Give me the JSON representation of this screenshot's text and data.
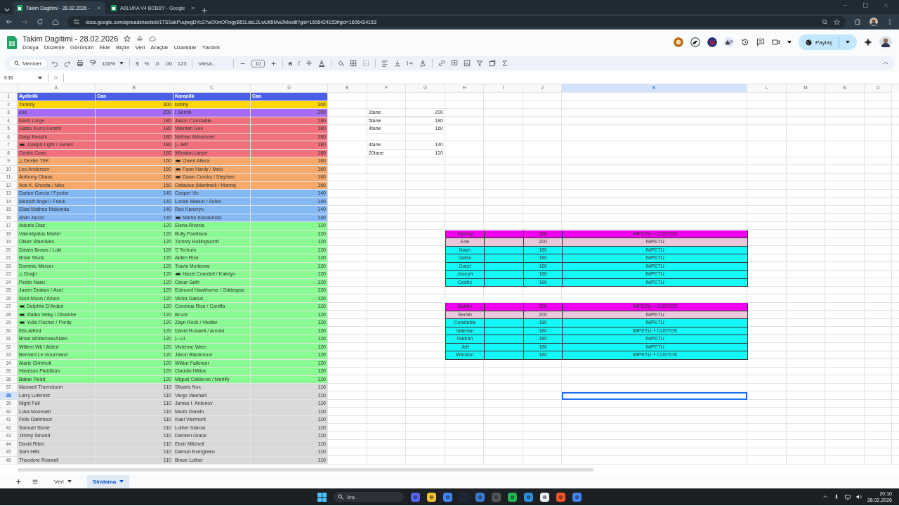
{
  "browser": {
    "tabs": [
      {
        "label": "Takim Dagitimi - 28.02.2026 -",
        "selected": true
      },
      {
        "label": "ABLUKA V4 BOBBY - Google",
        "selected": false
      }
    ],
    "address": "docs.google.com/spreadsheets/d/1TSSukPuujwgDYo37w0XmORngyB51LdcL2LwUti5Mw2M/edit?gid=1606424153#gid=1606424153"
  },
  "document": {
    "title": "Takim Dagitimi - 28.02.2026",
    "menus": [
      "Dosya",
      "Düzenle",
      "Görünüm",
      "Ekle",
      "Biçim",
      "Veri",
      "Araçlar",
      "Uzantılar",
      "Yardım"
    ],
    "share_label": "Paylaş"
  },
  "toolbar": {
    "search": "Menüler",
    "zoom": "100%",
    "currency": "$",
    "percent": "%",
    "decrease_decimals": ".0",
    "increase_decimals": ".00",
    "number_format": "123",
    "font": "Varsa...",
    "font_size": "10",
    "bold": "B",
    "italic": "I"
  },
  "formula_bar": {
    "name_box": "K38",
    "fx": "fx"
  },
  "columns": [
    {
      "label": "A",
      "selected": false
    },
    {
      "label": "B",
      "selected": false
    },
    {
      "label": "C",
      "selected": false
    },
    {
      "label": "D",
      "selected": false
    },
    {
      "label": "E",
      "selected": false
    },
    {
      "label": "F",
      "selected": false
    },
    {
      "label": "G",
      "selected": false
    },
    {
      "label": "H",
      "selected": false
    },
    {
      "label": "I",
      "selected": false
    },
    {
      "label": "J",
      "selected": false
    },
    {
      "label": "K",
      "selected": true
    },
    {
      "label": "L",
      "selected": false
    },
    {
      "label": "M",
      "selected": false
    },
    {
      "label": "N",
      "selected": false
    },
    {
      "label": "O",
      "selected": false
    }
  ],
  "rows": [
    {
      "number": "1",
      "selected": false,
      "kind": "header",
      "color": "#4a5ee6",
      "cells": [
        "Aydinlik",
        "Can",
        "Karanlik",
        "Can"
      ]
    },
    {
      "number": "2",
      "selected": false,
      "kind": "data",
      "color": "#ffd600",
      "cells": [
        "Tommy",
        "300",
        "bobby",
        "300"
      ]
    },
    {
      "number": "3",
      "selected": false,
      "kind": "data",
      "color": "#a66cf5",
      "cells": [
        "exe",
        "200",
        "I Semih",
        "200"
      ],
      "tally": [
        "1tane",
        "200"
      ]
    },
    {
      "number": "4",
      "selected": false,
      "kind": "data",
      "color": "#f0707c",
      "cells": [
        "Nash Lorge",
        "180",
        "Jason Constable",
        "180"
      ],
      "tally": [
        "5tane",
        "180"
      ]
    },
    {
      "number": "5",
      "selected": false,
      "kind": "data",
      "color": "#f0707c",
      "cells": [
        "Gatsu Kuroi Kenshi",
        "180",
        "Valerian Gek",
        "180"
      ],
      "tally": [
        "4tane",
        "160"
      ]
    },
    {
      "number": "6",
      "selected": false,
      "kind": "data",
      "color": "#f0707c",
      "cells": [
        "Daryl Kenshi",
        "180",
        "Nathan Ashmoore",
        "180"
      ]
    },
    {
      "number": "7",
      "selected": false,
      "kind": "data",
      "color": "#f0707c",
      "cells": [
        {
          "text": "Joseph Light / James",
          "emblem": true
        },
        "180",
        "▷ Jeff",
        "180"
      ],
      "tally": [
        "4tane",
        "140"
      ]
    },
    {
      "number": "8",
      "selected": false,
      "kind": "data",
      "color": "#f0707c",
      "cells": [
        "Cedric Cean",
        "180",
        "Winston Laryer",
        "180"
      ],
      "tally": [
        "20tane",
        "120"
      ]
    },
    {
      "number": "9",
      "selected": false,
      "kind": "data",
      "color": "#f6a96a",
      "cells": [
        "△ Dexter TEK",
        "160",
        {
          "text": "Owen Altera",
          "emblem": true
        },
        "160"
      ]
    },
    {
      "number": "10",
      "selected": false,
      "kind": "data",
      "color": "#f6a96a",
      "cells": [
        "Leo Anderson",
        "160",
        {
          "text": "Faon Hardy / Melo",
          "emblem": true
        },
        "160"
      ]
    },
    {
      "number": "11",
      "selected": false,
      "kind": "data",
      "color": "#f6a96a",
      "cells": [
        "Anthony Chaos",
        "160",
        {
          "text": "Dawn Crooks / Stephen",
          "emblem": true
        },
        "160"
      ]
    },
    {
      "number": "12",
      "selected": false,
      "kind": "data",
      "color": "#f6a96a",
      "cells": [
        "Ace K. Shoota / Niko",
        "160",
        "Octavius (Martinelli / Manraj",
        "160"
      ]
    },
    {
      "number": "13",
      "selected": false,
      "kind": "data",
      "color": "#84b9f6",
      "cells": [
        "Darian Garcia / Fyodor",
        "140",
        "Casper Vic",
        "140"
      ]
    },
    {
      "number": "14",
      "selected": false,
      "kind": "data",
      "color": "#84b9f6",
      "cells": [
        "Mestoff Angel / Frank",
        "140",
        "Lorian Maelor / Asher",
        "140"
      ]
    },
    {
      "number": "15",
      "selected": false,
      "kind": "data",
      "color": "#84b9f6",
      "cells": [
        "Elias Matheu Makonda",
        "140",
        "Reo Kaneryu",
        "140"
      ]
    },
    {
      "number": "16",
      "selected": false,
      "kind": "data",
      "color": "#84b9f6",
      "cells": [
        "Alvin Jacob",
        "140",
        {
          "text": "Martin Kasai/Asta",
          "emblem": true
        },
        "140"
      ]
    },
    {
      "number": "17",
      "selected": false,
      "kind": "data",
      "color": "#8afa92",
      "cells": [
        "Adonis Diaz",
        "120",
        "Elena Riveria",
        "120"
      ]
    },
    {
      "number": "18",
      "selected": false,
      "kind": "data",
      "color": "#8afa92",
      "cells": [
        "Valentiyatus Martel",
        "120",
        "Bully Paddison",
        "120"
      ],
      "summary": {
        "color": "#ee00ee",
        "cells": [
          "Tommy",
          "300",
          "IMPETU + CUSTOS"
        ]
      }
    },
    {
      "number": "19",
      "selected": false,
      "kind": "data",
      "color": "#8afa92",
      "cells": [
        "Oliver Stan/Alex",
        "120",
        "Tommy Hollingworth",
        "120"
      ],
      "summary": {
        "color": "#eac8dc",
        "cells": [
          "Exe",
          "200",
          "IMPETU"
        ]
      }
    },
    {
      "number": "20",
      "selected": false,
      "kind": "data",
      "color": "#8afa92",
      "cells": [
        "Daven Brows / Loki",
        "120",
        "▽ Terhum",
        "120"
      ],
      "summary": {
        "color": "#14f8f8",
        "cells": [
          "Nash",
          "180",
          "IMPETU"
        ]
      }
    },
    {
      "number": "21",
      "selected": false,
      "kind": "data",
      "color": "#8afa92",
      "cells": [
        "Brian Stuck",
        "120",
        "Aiden Rise",
        "120"
      ],
      "summary": {
        "color": "#14f8f8",
        "cells": [
          "Gatsu",
          "180",
          "IMPETU"
        ]
      }
    },
    {
      "number": "22",
      "selected": false,
      "kind": "data",
      "color": "#8afa92",
      "cells": [
        "Dominic Mercer",
        "120",
        "Travis Morleone",
        "120"
      ],
      "summary": {
        "color": "#14f8f8",
        "cells": [
          "Daryl",
          "180",
          "IMPETU"
        ]
      }
    },
    {
      "number": "23",
      "selected": false,
      "kind": "data",
      "color": "#8afa92",
      "cells": [
        "△ Dnajri",
        "120",
        {
          "text": "Hazel Crandell / Katelyn",
          "emblem": true
        },
        "120"
      ],
      "summary": {
        "color": "#14f8f8",
        "cells": [
          "Joseph",
          "180",
          "IMPETU"
        ]
      }
    },
    {
      "number": "24",
      "selected": false,
      "kind": "data",
      "color": "#8afa92",
      "cells": [
        "Pedro Nasu",
        "120",
        "Oscar Seth",
        "120"
      ],
      "summary": {
        "color": "#14f8f8",
        "cells": [
          "Cedric",
          "180",
          "IMPETU"
        ]
      }
    },
    {
      "number": "25",
      "selected": false,
      "kind": "data",
      "color": "#8afa92",
      "cells": [
        "Jaxen Draken / Axel",
        "120",
        "Edmund Hawthorne / Oddesyss",
        "120"
      ]
    },
    {
      "number": "26",
      "selected": false,
      "kind": "data",
      "color": "#8afa92",
      "cells": [
        "Noni Moon / Amon",
        "120",
        "Victor Ganus",
        "120"
      ]
    },
    {
      "number": "27",
      "selected": false,
      "kind": "data",
      "color": "#8afa92",
      "cells": [
        {
          "text": "Delphini D'Arden",
          "emblem": true
        },
        "120",
        "Corvinus Rice / Coniffa",
        "120"
      ],
      "summary": {
        "color": "#ee00ee",
        "cells": [
          "Bobby",
          "300",
          "IMPETU + CUSTOS"
        ]
      }
    },
    {
      "number": "28",
      "selected": false,
      "kind": "data",
      "color": "#8afa92",
      "cells": [
        {
          "text": "Zlatko Velky / Obambe",
          "emblem": true
        },
        "120",
        "Bruce",
        "120"
      ],
      "summary": {
        "color": "#eac8dc",
        "cells": [
          "Semih",
          "200",
          "IMPETU"
        ]
      }
    },
    {
      "number": "29",
      "selected": false,
      "kind": "data",
      "color": "#8afa92",
      "cells": [
        {
          "text": "Yulis Fischer / Pordy",
          "emblem": true
        },
        "120",
        "Zayn Rock / Vestler",
        "120"
      ],
      "summary": {
        "color": "#14f8f8",
        "cells": [
          "Constable",
          "180",
          "IMPETU"
        ]
      }
    },
    {
      "number": "30",
      "selected": false,
      "kind": "data",
      "color": "#8afa92",
      "cells": [
        "Elio Alfred",
        "120",
        "David Roswell / Arnold",
        "120"
      ],
      "summary": {
        "color": "#14f8f8",
        "cells": [
          "Valerian",
          "180",
          "IMPETU + CUSTOS"
        ]
      }
    },
    {
      "number": "31",
      "selected": false,
      "kind": "data",
      "color": "#8afa92",
      "cells": [
        "Brian Whiterose/Aiden",
        "120",
        "▷ Lil",
        "120"
      ],
      "summary": {
        "color": "#14f8f8",
        "cells": [
          "Nathan",
          "180",
          "IMPETU"
        ]
      }
    },
    {
      "number": "32",
      "selected": false,
      "kind": "data",
      "color": "#8afa92",
      "cells": [
        "Willem Wit / Aldert",
        "120",
        "Vivienne Wren",
        "120"
      ],
      "summary": {
        "color": "#14f8f8",
        "cells": [
          "Jeff",
          "180",
          "IMPETU"
        ]
      }
    },
    {
      "number": "33",
      "selected": false,
      "kind": "data",
      "color": "#8afa92",
      "cells": [
        "Bernard Le Gourmand",
        "120",
        "Jaxon Blackmoor",
        "120"
      ],
      "summary": {
        "color": "#14f8f8",
        "cells": [
          "Winston",
          "180",
          "IMPETU + CUSTOS"
        ]
      }
    },
    {
      "number": "34",
      "selected": false,
      "kind": "data",
      "color": "#8afa92",
      "cells": [
        "Alaric Grimholt",
        "120",
        "Wildur Falkneer",
        "120"
      ]
    },
    {
      "number": "35",
      "selected": false,
      "kind": "data",
      "color": "#8afa92",
      "cells": [
        "Havesso Paddison",
        "120",
        "Claudio Hillios",
        "120"
      ]
    },
    {
      "number": "36",
      "selected": false,
      "kind": "data",
      "color": "#8afa92",
      "cells": [
        "Baber Redd",
        "120",
        "Miguel Calderon / Merlify",
        "120"
      ]
    },
    {
      "number": "37",
      "selected": false,
      "kind": "data",
      "color": "#d9d9d9",
      "cells": [
        "Maxwell Themdoom",
        "110",
        "Silvaris Nox",
        "110"
      ]
    },
    {
      "number": "38",
      "selected": true,
      "kind": "data",
      "color": "#d9d9d9",
      "cells": [
        "Larry Lufenniz",
        "110",
        "Viego Valehart",
        "110"
      ]
    },
    {
      "number": "39",
      "selected": false,
      "kind": "data",
      "color": "#d9d9d9",
      "cells": [
        "Night Fall",
        "110",
        "James I. Antonov",
        "110"
      ]
    },
    {
      "number": "40",
      "selected": false,
      "kind": "data",
      "color": "#d9d9d9",
      "cells": [
        "Luka Moonveil",
        "110",
        "Madn Darwin",
        "110"
      ]
    },
    {
      "number": "41",
      "selected": false,
      "kind": "data",
      "color": "#d9d9d9",
      "cells": [
        "Felix Darkmoor",
        "110",
        "Kael Viermont",
        "110"
      ]
    },
    {
      "number": "42",
      "selected": false,
      "kind": "data",
      "color": "#d9d9d9",
      "cells": [
        "Samuel Stone",
        "110",
        "Luther Slarow",
        "110"
      ]
    },
    {
      "number": "43",
      "selected": false,
      "kind": "data",
      "color": "#d9d9d9",
      "cells": [
        "Jimmy Smond",
        "110",
        "Damien Grace",
        "110"
      ]
    },
    {
      "number": "44",
      "selected": false,
      "kind": "data",
      "color": "#d9d9d9",
      "cells": [
        "David Ribel",
        "110",
        "Elmir Mitchell",
        "110"
      ]
    },
    {
      "number": "45",
      "selected": false,
      "kind": "data",
      "color": "#d9d9d9",
      "cells": [
        "Sam Hills",
        "110",
        "Damon Evergreen",
        "110"
      ]
    },
    {
      "number": "46",
      "selected": false,
      "kind": "data",
      "color": "#d9d9d9",
      "cells": [
        "Theodore Roswell",
        "110",
        "Brave Luther",
        "110"
      ]
    }
  ],
  "sheet_tabs": [
    {
      "label": "Veri",
      "selected": false
    },
    {
      "label": "Siralama",
      "selected": true
    }
  ],
  "taskbar": {
    "search": "Ara",
    "time": "20:10",
    "date": "28.02.2026"
  }
}
